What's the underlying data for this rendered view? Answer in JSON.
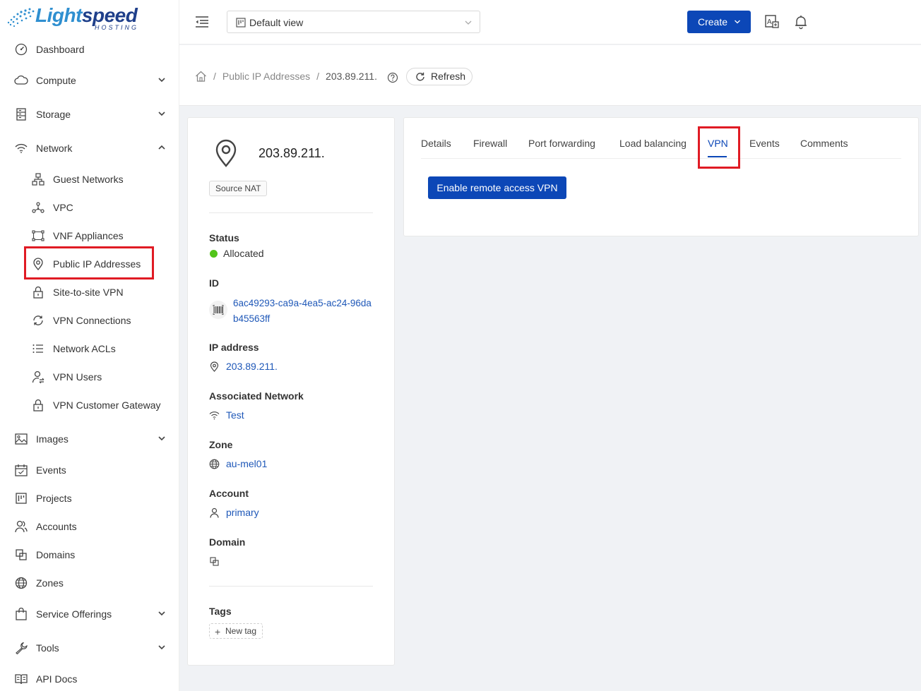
{
  "app": {
    "logo_text_light": "Light",
    "logo_text_speed": "speed",
    "logo_sub": "HOSTING"
  },
  "sidebar": {
    "items": [
      {
        "label": "Dashboard",
        "icon": "dashboard-icon"
      },
      {
        "label": "Compute",
        "icon": "cloud-icon",
        "expandable": true
      },
      {
        "label": "Storage",
        "icon": "storage-icon",
        "expandable": true
      },
      {
        "label": "Network",
        "icon": "wifi-icon",
        "expandable": true,
        "expanded": true
      },
      {
        "label": "Images",
        "icon": "image-icon",
        "expandable": true
      },
      {
        "label": "Events",
        "icon": "calendar-icon"
      },
      {
        "label": "Projects",
        "icon": "project-icon"
      },
      {
        "label": "Accounts",
        "icon": "users-icon"
      },
      {
        "label": "Domains",
        "icon": "domains-icon"
      },
      {
        "label": "Zones",
        "icon": "globe-icon"
      },
      {
        "label": "Service Offerings",
        "icon": "shopping-bag-icon",
        "expandable": true
      },
      {
        "label": "Tools",
        "icon": "wrench-icon",
        "expandable": true
      },
      {
        "label": "API Docs",
        "icon": "book-icon"
      }
    ],
    "network_sub": [
      {
        "label": "Guest Networks",
        "icon": "cluster-icon"
      },
      {
        "label": "VPC",
        "icon": "deployment-icon"
      },
      {
        "label": "VNF Appliances",
        "icon": "gateway-icon"
      },
      {
        "label": "Public IP Addresses",
        "icon": "location-pin-icon",
        "selected": true
      },
      {
        "label": "Site-to-site VPN",
        "icon": "lock-icon"
      },
      {
        "label": "VPN Connections",
        "icon": "sync-icon"
      },
      {
        "label": "Network ACLs",
        "icon": "list-icon"
      },
      {
        "label": "VPN Users",
        "icon": "user-switch-icon"
      },
      {
        "label": "VPN Customer Gateway",
        "icon": "lock-icon"
      }
    ]
  },
  "topbar": {
    "view_select": "Default view",
    "create_label": "Create"
  },
  "breadcrumb": {
    "items": [
      "Public IP Addresses",
      "203.89.211."
    ],
    "refresh_label": "Refresh"
  },
  "resource": {
    "title": "203.89.211.",
    "badge": "Source NAT",
    "status_label": "Status",
    "status_value": "Allocated",
    "status_color": "#52c41a",
    "id_label": "ID",
    "id_value": "6ac49293-ca9a-4ea5-ac24-96dab45563ff",
    "ip_label": "IP address",
    "ip_value": "203.89.211.",
    "network_label": "Associated Network",
    "network_value": "Test",
    "zone_label": "Zone",
    "zone_value": "au-mel01",
    "account_label": "Account",
    "account_value": "primary",
    "domain_label": "Domain",
    "tags_label": "Tags",
    "new_tag_label": "New tag"
  },
  "tabs": {
    "items": [
      "Details",
      "Firewall",
      "Port forwarding",
      "Load balancing",
      "VPN",
      "Events",
      "Comments"
    ],
    "active": "VPN",
    "enable_vpn_label": "Enable remote access VPN"
  },
  "colors": {
    "accent": "#0c47b7",
    "link": "#1f58b8",
    "highlight_box": "#e01b24"
  }
}
